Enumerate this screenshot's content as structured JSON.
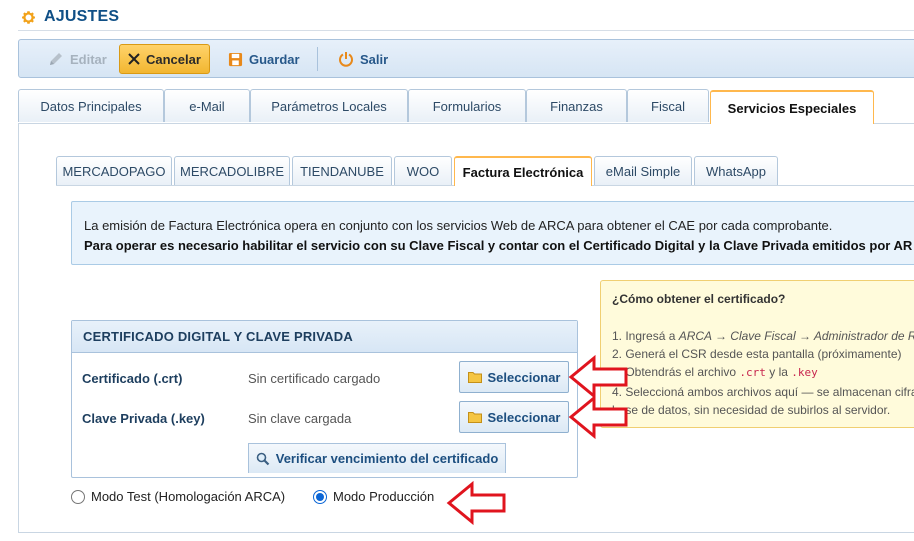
{
  "header": {
    "title": "AJUSTES",
    "icon": "gear-icon"
  },
  "toolbar": {
    "edit_label": "Editar",
    "cancel_label": "Cancelar",
    "save_label": "Guardar",
    "exit_label": "Salir"
  },
  "tabs": [
    {
      "label": "Datos Principales"
    },
    {
      "label": "e-Mail"
    },
    {
      "label": "Parámetros Locales"
    },
    {
      "label": "Formularios"
    },
    {
      "label": "Finanzas"
    },
    {
      "label": "Fiscal"
    },
    {
      "label": "Servicios Especiales",
      "active": true
    }
  ],
  "subtabs": [
    {
      "label": "MERCADOPAGO"
    },
    {
      "label": "MERCADOLIBRE"
    },
    {
      "label": "TIENDANUBE"
    },
    {
      "label": "WOO"
    },
    {
      "label": "Factura Electrónica",
      "active": true
    },
    {
      "label": "eMail Simple"
    },
    {
      "label": "WhatsApp"
    }
  ],
  "info": {
    "line1": "La emisión de Factura Electrónica opera en conjunto con los servicios Web de ARCA para obtener el CAE por cada comprobante.",
    "line2": "Para operar es necesario habilitar el servicio con su Clave Fiscal y contar con el Certificado Digital y la Clave Privada emitidos por AR"
  },
  "help": {
    "title": "¿Cómo obtener el certificado?",
    "step1_prefix": "1. Ingresá a ",
    "step1_path": "ARCA → Clave Fiscal → Administrador de Re",
    "step2": "2. Generá el CSR desde esta pantalla (próximamente)",
    "step3_prefix": "3. Obtendrás el archivo ",
    "step3_code1": ".crt",
    "step3_mid": " y la ",
    "step3_code2": ".key",
    "step4_line1": "4. Seleccioná ambos archivos aquí — se almacenan cifra",
    "step4_line2": "base de datos, sin necesidad de subirlos al servidor."
  },
  "cert_panel": {
    "title": "CERTIFICADO DIGITAL Y CLAVE PRIVADA",
    "cert_label": "Certificado (.crt)",
    "cert_status": "Sin certificado cargado",
    "key_label": "Clave Privada (.key)",
    "key_status": "Sin clave cargada",
    "select_label": "Seleccionar",
    "verify_label": "Verificar vencimiento del certificado"
  },
  "mode": {
    "test_label": "Modo Test (Homologación ARCA)",
    "prod_label": "Modo Producción",
    "selected": "prod"
  },
  "colors": {
    "title": "#0f4f86",
    "accent": "#f2b631",
    "annotation_arrow": "#e0141e",
    "radio_selected": "#0b66d6"
  }
}
